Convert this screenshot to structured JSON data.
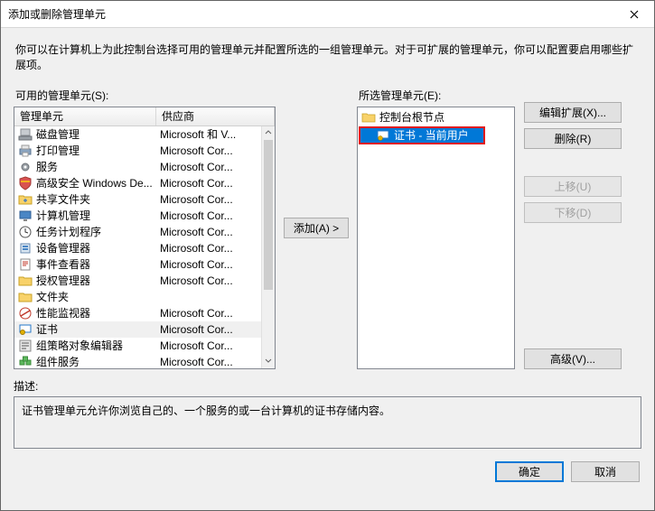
{
  "window": {
    "title": "添加或删除管理单元"
  },
  "instruction": "你可以在计算机上为此控制台选择可用的管理单元并配置所选的一组管理单元。对于可扩展的管理单元，你可以配置要启用哪些扩展项。",
  "available": {
    "label": "可用的管理单元(S):",
    "headers": {
      "name": "管理单元",
      "vendor": "供应商"
    },
    "items": [
      {
        "name": "磁盘管理",
        "vendor": "Microsoft 和 V...",
        "icon": "disk"
      },
      {
        "name": "打印管理",
        "vendor": "Microsoft Cor...",
        "icon": "printer"
      },
      {
        "name": "服务",
        "vendor": "Microsoft Cor...",
        "icon": "gear"
      },
      {
        "name": "高级安全 Windows De...",
        "vendor": "Microsoft Cor...",
        "icon": "shield"
      },
      {
        "name": "共享文件夹",
        "vendor": "Microsoft Cor...",
        "icon": "share"
      },
      {
        "name": "计算机管理",
        "vendor": "Microsoft Cor...",
        "icon": "computer"
      },
      {
        "name": "任务计划程序",
        "vendor": "Microsoft Cor...",
        "icon": "clock"
      },
      {
        "name": "设备管理器",
        "vendor": "Microsoft Cor...",
        "icon": "device"
      },
      {
        "name": "事件查看器",
        "vendor": "Microsoft Cor...",
        "icon": "event"
      },
      {
        "name": "授权管理器",
        "vendor": "Microsoft Cor...",
        "icon": "folder"
      },
      {
        "name": "文件夹",
        "vendor": "",
        "icon": "folder"
      },
      {
        "name": "性能监视器",
        "vendor": "Microsoft Cor...",
        "icon": "perf"
      },
      {
        "name": "证书",
        "vendor": "Microsoft Cor...",
        "icon": "cert",
        "selected": true
      },
      {
        "name": "组策略对象编辑器",
        "vendor": "Microsoft Cor...",
        "icon": "gpo"
      },
      {
        "name": "组件服务",
        "vendor": "Microsoft Cor...",
        "icon": "component"
      }
    ]
  },
  "selected": {
    "label": "所选管理单元(E):",
    "root": "控制台根节点",
    "item": "证书 - 当前用户"
  },
  "buttons": {
    "add": "添加(A) >",
    "edit_ext": "编辑扩展(X)...",
    "remove": "删除(R)",
    "move_up": "上移(U)",
    "move_down": "下移(D)",
    "advanced": "高级(V)...",
    "ok": "确定",
    "cancel": "取消"
  },
  "description": {
    "label": "描述:",
    "text": "证书管理单元允许你浏览自己的、一个服务的或一台计算机的证书存储内容。"
  }
}
